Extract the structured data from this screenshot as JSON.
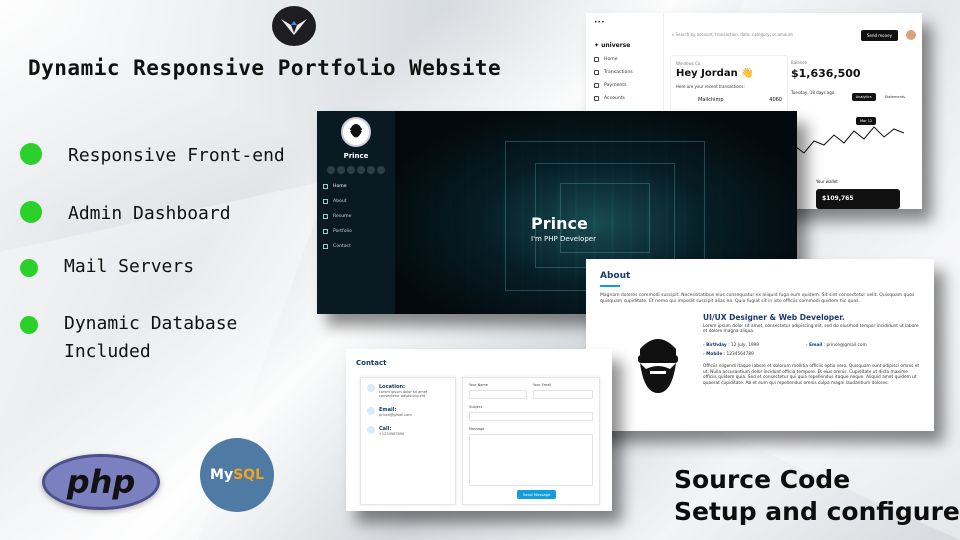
{
  "headline": "Dynamic Responsive Portfolio Website",
  "features": [
    "Responsive Front-end",
    "Admin Dashboard",
    "Mail Servers",
    "Dynamic Database",
    "Included"
  ],
  "logos": {
    "php": "php",
    "mysql_a": "My",
    "mysql_b": "SQL"
  },
  "dashboard": {
    "brand": "universe",
    "search_placeholder": "Search by account, transaction, date, category, or amount",
    "send_button": "Send money",
    "nav": [
      "Home",
      "Transactions",
      "Payments",
      "Accounts"
    ],
    "greet_small": "Windows Co.",
    "greet": "Hey Jordan 👋",
    "recent_label": "Here are your recent transactions:",
    "tx_name": "Mailchimp",
    "tx_amount": "4060",
    "balance_label": "Balance",
    "balance": "$1,636,500",
    "balance_date": "Tuesday, 18 days ago",
    "pill_a": "Analytics",
    "pill_b": "Statements",
    "wallet_label": "Your wallet",
    "wallet_amount": "$109,765",
    "chart_tag": "Mar 12"
  },
  "hero": {
    "sidebar_name": "Prince",
    "menu": [
      "Home",
      "About",
      "Resume",
      "Portfolio",
      "Contact"
    ],
    "title": "Prince",
    "subtitle": "I'm PHP Developer"
  },
  "about": {
    "heading": "About",
    "intro": "Magnam dolores commodi suscipit. Necessitatibus eius consequatur ex aliquid fuga eum quidem. Sit sint consectetur velit. Quisquam quos quisquam cupiditate. Et nemo qui impedit suscipit alias ea. Quia fugiat sit in iste officiis commodi quidem hic quas.",
    "role": "UI/UX Designer & Web Developer.",
    "role_desc": "Lorem ipsum dolor sit amet, consectetur adipiscing elit, sed do eiusmod tempor incididunt ut labore et dolore magna aliqua.",
    "birthday_label": "Birthday",
    "birthday": ": 12 July, 1999",
    "email_label": "Email",
    "email": ": prince@gmail.com",
    "mobile_label": "Mobile",
    "mobile": ": 1234564789",
    "body": "Officiis eligendi itaque labore et dolorum mollitia officiis optio vero. Quisquam sunt adipisci omnis et ut. Nulla accusantium dolor incidunt officia tempore. Et eius omnis. Cupiditate ut dicta maxime officiis quidem quia. Sed et consectetur qui quia repellendus itaque neque. Aliquid amet quidem ut quaerat cupiditate. Ab et eum qui repellendus omnis culpa magni laudantium dolores."
  },
  "contact": {
    "heading": "Contact",
    "location_label": "Location:",
    "location": "Lorem ipsum dolor sit amet consectetur adipiscing elit",
    "email_label": "Email:",
    "email": "prince@gmail.com",
    "call_label": "Call:",
    "call": "+1234567890",
    "name_label": "Your Name",
    "email_field_label": "Your Email",
    "subject_label": "Subject",
    "message_label": "Message",
    "send_button": "Send Message"
  },
  "source": {
    "line1": "Source Code",
    "line2": "Setup and configure"
  },
  "colors": {
    "dot": "#2bd12b",
    "accent": "#149ddd",
    "heading": "#173b6c"
  }
}
